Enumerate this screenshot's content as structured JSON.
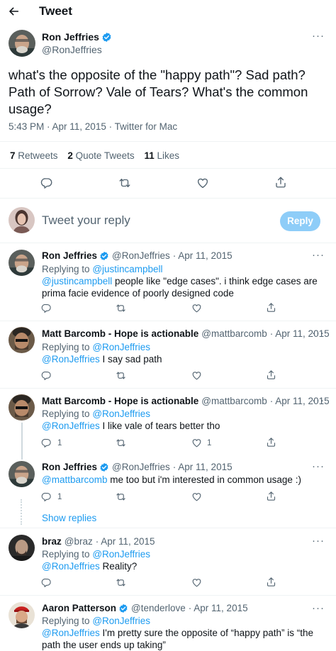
{
  "header": {
    "title": "Tweet"
  },
  "main_tweet": {
    "author_name": "Ron Jeffries",
    "handle": "@RonJeffries",
    "text": "what's the opposite of the \"happy path\"? Sad path? Path of Sorrow? Vale of Tears? What's the common usage?",
    "timestamp": "5:43 PM · Apr 11, 2015 · Twitter for Mac",
    "stats": {
      "retweets_count": "7",
      "retweets_label": "Retweets",
      "quotes_count": "2",
      "quotes_label": "Quote Tweets",
      "likes_count": "11",
      "likes_label": "Likes"
    }
  },
  "reply_box": {
    "placeholder": "Tweet your reply",
    "button_label": "Reply"
  },
  "replies": [
    {
      "name": "Ron Jeffries",
      "handle": "@RonJeffries",
      "date": "· Apr 11, 2015",
      "replying_prefix": "Replying to",
      "replying_to": "@justincampbell",
      "mention": "@justincampbell",
      "text": " people like \"edge cases\". i think edge cases are prima facie evidence of poorly designed code"
    },
    {
      "name": "Matt Barcomb - Hope is actionable",
      "handle": "@mattbarcomb",
      "date": "· Apr 11, 2015",
      "replying_prefix": "Replying to",
      "replying_to": "@RonJeffries",
      "mention": "@RonJeffries",
      "text": " I say sad path"
    },
    {
      "name": "Matt Barcomb - Hope is actionable",
      "handle": "@mattbarcomb",
      "date": "· Apr 11, 2015",
      "replying_prefix": "Replying to",
      "replying_to": "@RonJeffries",
      "mention": "@RonJeffries",
      "text": " I like vale of tears better tho",
      "reply_count": "1",
      "like_count": "1"
    },
    {
      "name": "Ron Jeffries",
      "handle": "@RonJeffries",
      "date": "· Apr 11, 2015",
      "mention": "@mattbarcomb",
      "text": " me too but i'm interested in common usage :)",
      "reply_count": "1"
    },
    {
      "name": "braz",
      "handle": "@braz",
      "date": "· Apr 11, 2015",
      "replying_prefix": "Replying to",
      "replying_to": "@RonJeffries",
      "mention": "@RonJeffries",
      "text": " Reality?"
    },
    {
      "name": "Aaron Patterson",
      "handle": "@tenderlove",
      "date": "· Apr 11, 2015",
      "replying_prefix": "Replying to",
      "replying_to": "@RonJeffries",
      "mention": "@RonJeffries",
      "text": " I'm pretty sure the opposite of “happy path” is “the path the user ends up taking”"
    }
  ],
  "show_replies": "Show replies",
  "colors": {
    "accent": "#1d9bf0",
    "reply_button": "#8ecdf8",
    "text": "#0f1419",
    "secondary": "#536471"
  }
}
